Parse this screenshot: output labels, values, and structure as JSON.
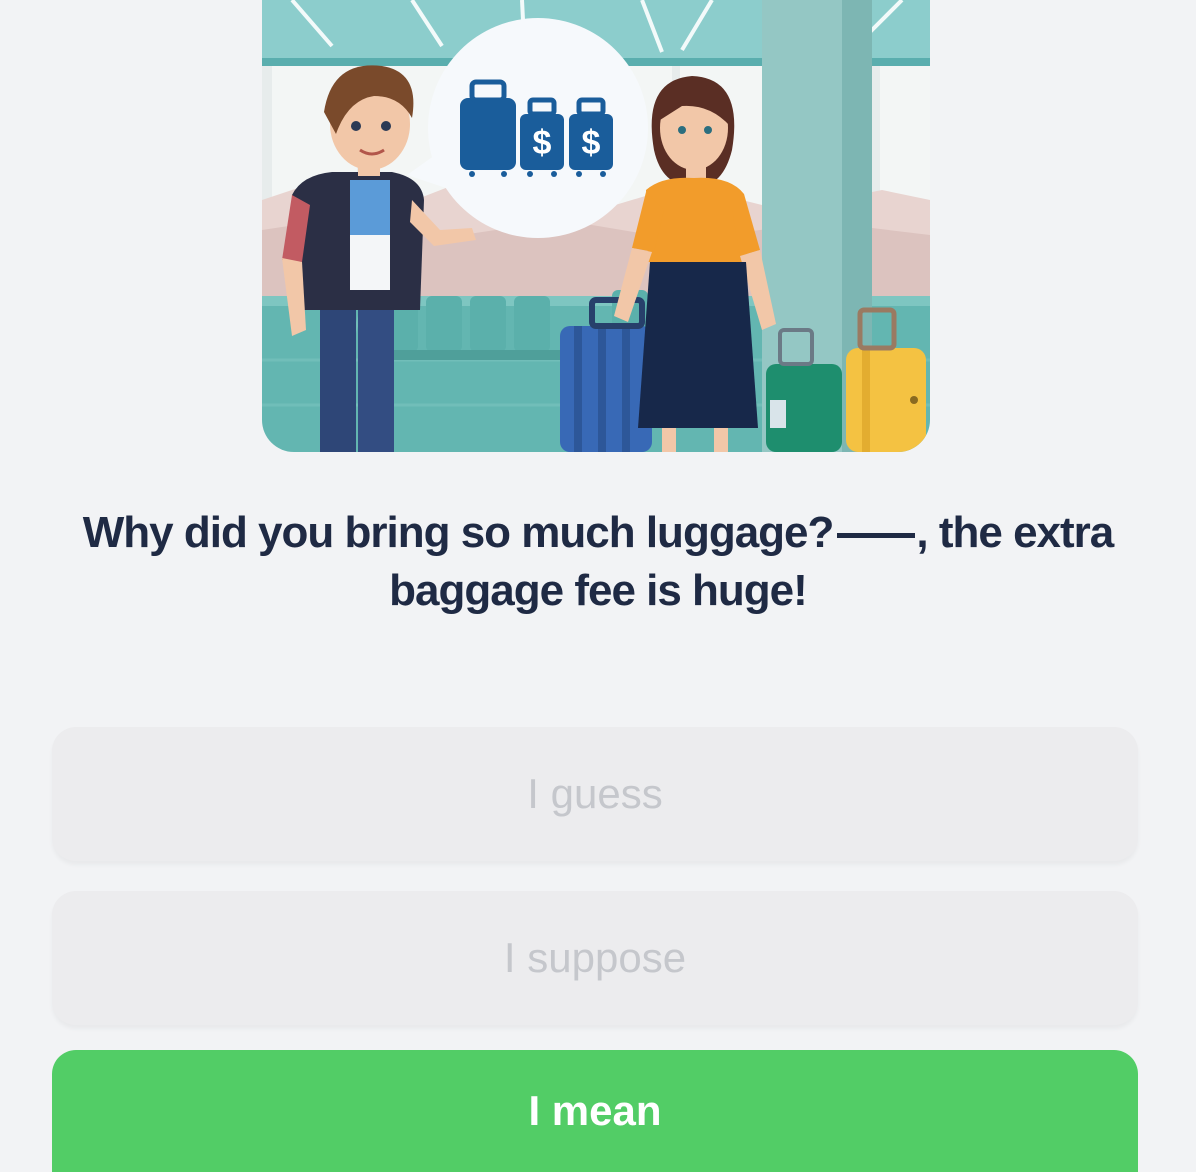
{
  "question": {
    "before_blank": "Why did you bring so much luggage?",
    "after_blank": ", the extra baggage fee is huge!"
  },
  "speech_bubble": {
    "icon": "luggage-dollar-icon",
    "symbol_1": "$",
    "symbol_2": "$"
  },
  "options": [
    {
      "label": "I guess",
      "state": "disabled"
    },
    {
      "label": "I suppose",
      "state": "disabled"
    },
    {
      "label": "I mean",
      "state": "selected"
    }
  ],
  "colors": {
    "background": "#f2f3f5",
    "text_primary": "#1f2a44",
    "option_bg": "#ececee",
    "option_text": "#c5c7cc",
    "selected_bg": "#52cd66",
    "selected_text": "#ffffff"
  }
}
